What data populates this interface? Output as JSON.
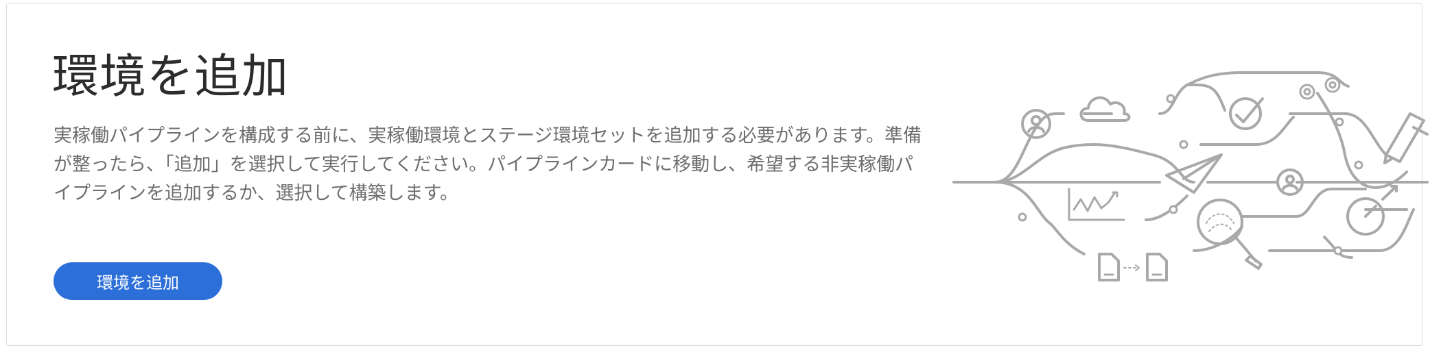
{
  "page": {
    "title": "環境を追加",
    "description": "実稼働パイプラインを構成する前に、実稼働環境とステージ環境セットを追加する必要があります。準備が整ったら、「追加」を選択して実行してください。パイプラインカードに移動し、希望する非実稼働パイプラインを追加するか、選択して構築します。",
    "cta_label": "環境を追加"
  },
  "colors": {
    "accent": "#2d6fd9",
    "illustration": "#a9a9a9"
  },
  "illustration": {
    "icons": [
      "user-icon",
      "cloud-icon",
      "checkmark-icon",
      "gear-icon",
      "pen-icon",
      "paper-plane-icon",
      "user-icon",
      "chart-icon",
      "magnifier-icon",
      "gauge-icon",
      "document-icon",
      "document-icon"
    ]
  }
}
